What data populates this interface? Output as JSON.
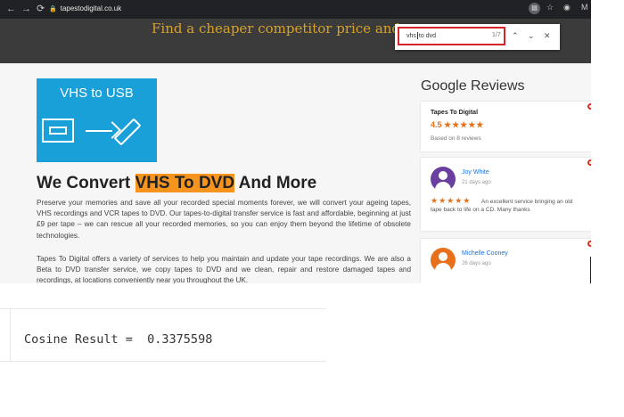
{
  "browser": {
    "url": "tapestodigital.co.uk",
    "find": {
      "query_before": "vhs",
      "query_after": "to dvd",
      "count": "1/7"
    },
    "ext_label": "M"
  },
  "hero": {
    "text": "Find a cheaper competitor price and w"
  },
  "logo": {
    "title": "VHS to USB"
  },
  "article": {
    "heading_pre": "We Convert ",
    "heading_highlight": "VHS To DVD",
    "heading_post": " And More",
    "para1": "Preserve your memories and save all your recorded special moments forever, we will convert your ageing tapes, VHS recordings and VCR tapes to DVD. Our tapes-to-digital transfer service is fast and affordable, beginning at just £9 per tape – we can rescue all your recorded memories, so you can enjoy them beyond the lifetime of obsolete technologies.",
    "para2": "Tapes To Digital offers a variety of services to help you maintain and update your tape recordings. We are also a Beta to DVD transfer service, we copy tapes to DVD and we clean, repair and restore damaged tapes and recordings, at locations conveniently near you throughout the UK."
  },
  "reviews": {
    "title": "Google Reviews",
    "business": "Tapes To Digital",
    "rating": "4.5",
    "rating_stars": "★★★★★",
    "based_on": "Based on 8 reviews",
    "items": [
      {
        "name": "Joy White",
        "date": "21 days ago",
        "stars": "★★★★★",
        "text": "An excellent service bringing an old",
        "text2": "tape back to life on a CD. Many thanks",
        "avatar_color": "#6b3fa0"
      },
      {
        "name": "Michelle Cooney",
        "date": "26 days ago",
        "avatar_color": "#e8701a"
      }
    ]
  },
  "console": {
    "output": "Cosine Result =  0.3375598"
  }
}
